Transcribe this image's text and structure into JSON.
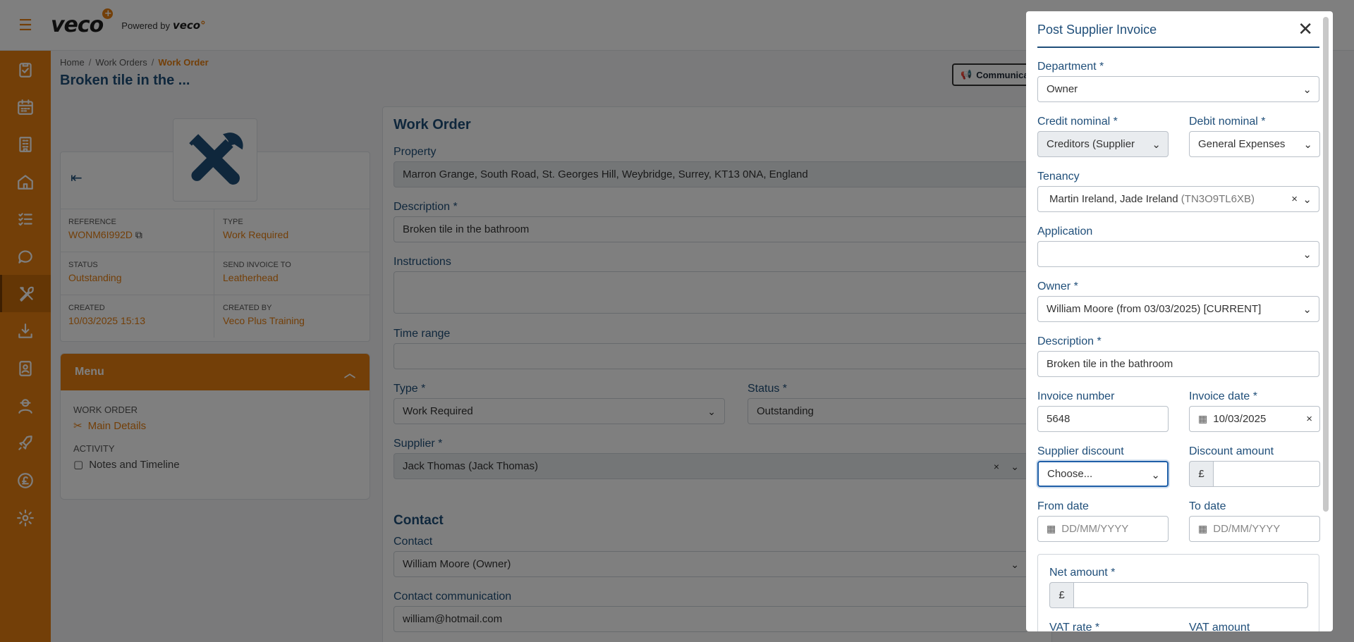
{
  "topbar": {
    "logo": "veco",
    "logo_plus": "+",
    "powered_by": "Powered by",
    "powered_logo": "veco",
    "powered_logo_dot": "°"
  },
  "sidebar": {
    "items": [
      "tasks-icon",
      "calendar-icon",
      "building-icon",
      "home-icon",
      "list-icon",
      "chat-icon",
      "tools-icon",
      "download-icon",
      "contacts-icon",
      "person-icon",
      "rocket-icon",
      "pound-icon",
      "gear-icon"
    ]
  },
  "breadcrumb": {
    "home": "Home",
    "sep": "/",
    "work_orders": "Work Orders",
    "current": "Work Order"
  },
  "page_title": "Broken tile in the ...",
  "communicate_label": "Communica",
  "info": {
    "reference_label": "REFERENCE",
    "reference": "WONM6I992D",
    "type_label": "TYPE",
    "type": "Work Required",
    "status_label": "STATUS",
    "status": "Outstanding",
    "send_invoice_label": "SEND INVOICE TO",
    "send_invoice": "Leatherhead",
    "created_label": "CREATED",
    "created": "10/03/2025 15:13",
    "created_by_label": "CREATED BY",
    "created_by": "Veco Plus Training"
  },
  "menu": {
    "title": "Menu",
    "section_work_order": "WORK ORDER",
    "main_details": "Main Details",
    "section_activity": "ACTIVITY",
    "notes_timeline": "Notes and Timeline"
  },
  "work_order": {
    "title": "Work Order",
    "property_label": "Property",
    "property": "Marron Grange, South Road, St. Georges Hill, Weybridge, Surrey, KT13 0NA, England",
    "description_label": "Description *",
    "description": "Broken tile in the bathroom",
    "instructions_label": "Instructions",
    "time_range_label": "Time range",
    "type_label": "Type *",
    "type": "Work Required",
    "status_label": "Status *",
    "status": "Outstanding",
    "supplier_label": "Supplier *",
    "supplier": "Jack Thomas (Jack Thomas)",
    "contact_section": "Contact",
    "contact_label": "Contact",
    "contact": "William Moore (Owner)",
    "contact_comm_label": "Contact communication",
    "contact_comm": "william@hotmail.com"
  },
  "modal": {
    "title": "Post Supplier Invoice",
    "department_label": "Department *",
    "department": "Owner",
    "credit_label": "Credit nominal *",
    "credit": "Creditors (Supplier",
    "debit_label": "Debit nominal *",
    "debit": "General Expenses",
    "tenancy_label": "Tenancy",
    "tenancy_name": "Martin Ireland, Jade Ireland",
    "tenancy_code": "(TN3O9TL6XB)",
    "application_label": "Application",
    "owner_label": "Owner *",
    "owner": "William Moore (from 03/03/2025) [CURRENT]",
    "description_label": "Description *",
    "description": "Broken tile in the bathroom",
    "invoice_number_label": "Invoice number",
    "invoice_number": "5648",
    "invoice_date_label": "Invoice date *",
    "invoice_date": "10/03/2025",
    "supplier_discount_label": "Supplier discount",
    "supplier_discount": "Choose...",
    "discount_amount_label": "Discount amount",
    "currency": "£",
    "from_date_label": "From date",
    "from_date_placeholder": "DD/MM/YYYY",
    "to_date_label": "To date",
    "to_date_placeholder": "DD/MM/YYYY",
    "net_amount_label": "Net amount *",
    "vat_rate_label": "VAT rate *",
    "vat_amount_label": "VAT amount"
  },
  "colors": {
    "brand": "#e67e10",
    "navy": "#1f4e79"
  }
}
